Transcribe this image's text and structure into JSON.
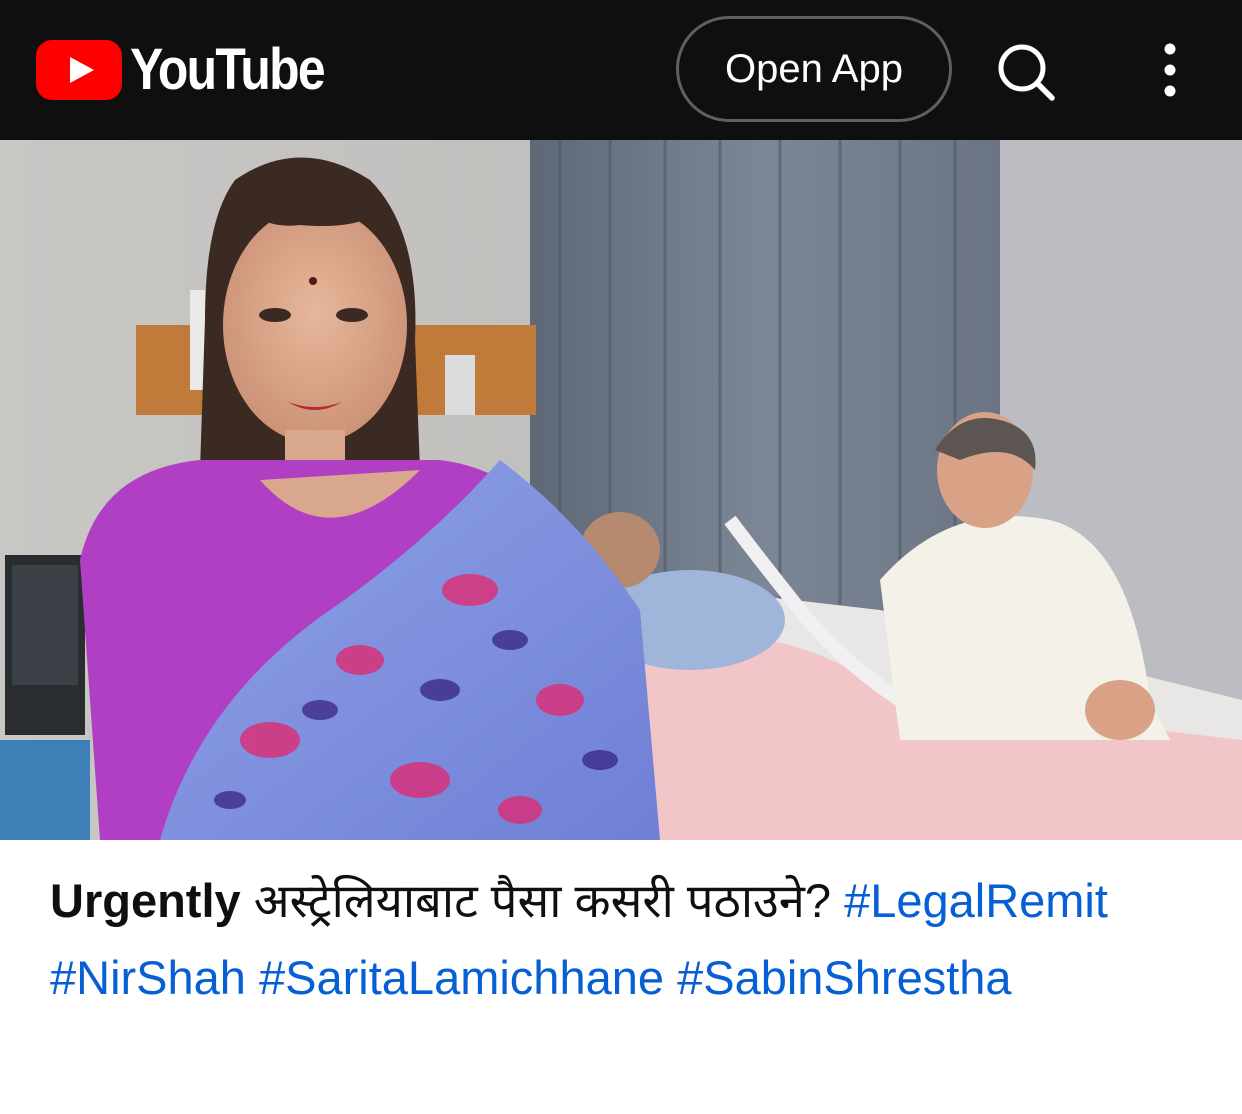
{
  "header": {
    "logo_text": "YouTube",
    "logo_icon": "youtube-play-icon",
    "open_app_label": "Open App",
    "search_icon": "search-icon",
    "more_icon": "more-vert-icon",
    "background_color": "#0f0f0f",
    "brand_color": "#ff0000"
  },
  "video": {
    "thumbnail_icon": "video-thumbnail"
  },
  "title": {
    "lead": "Urgently",
    "text": "अस्ट्रेलियाबाट पैसा कसरी पठाउने?",
    "hashtags": [
      "#LegalRemit",
      "#NirShah",
      "#SaritaLamichhane",
      "#SabinShrestha"
    ],
    "hashtag_color": "#065fd4"
  }
}
